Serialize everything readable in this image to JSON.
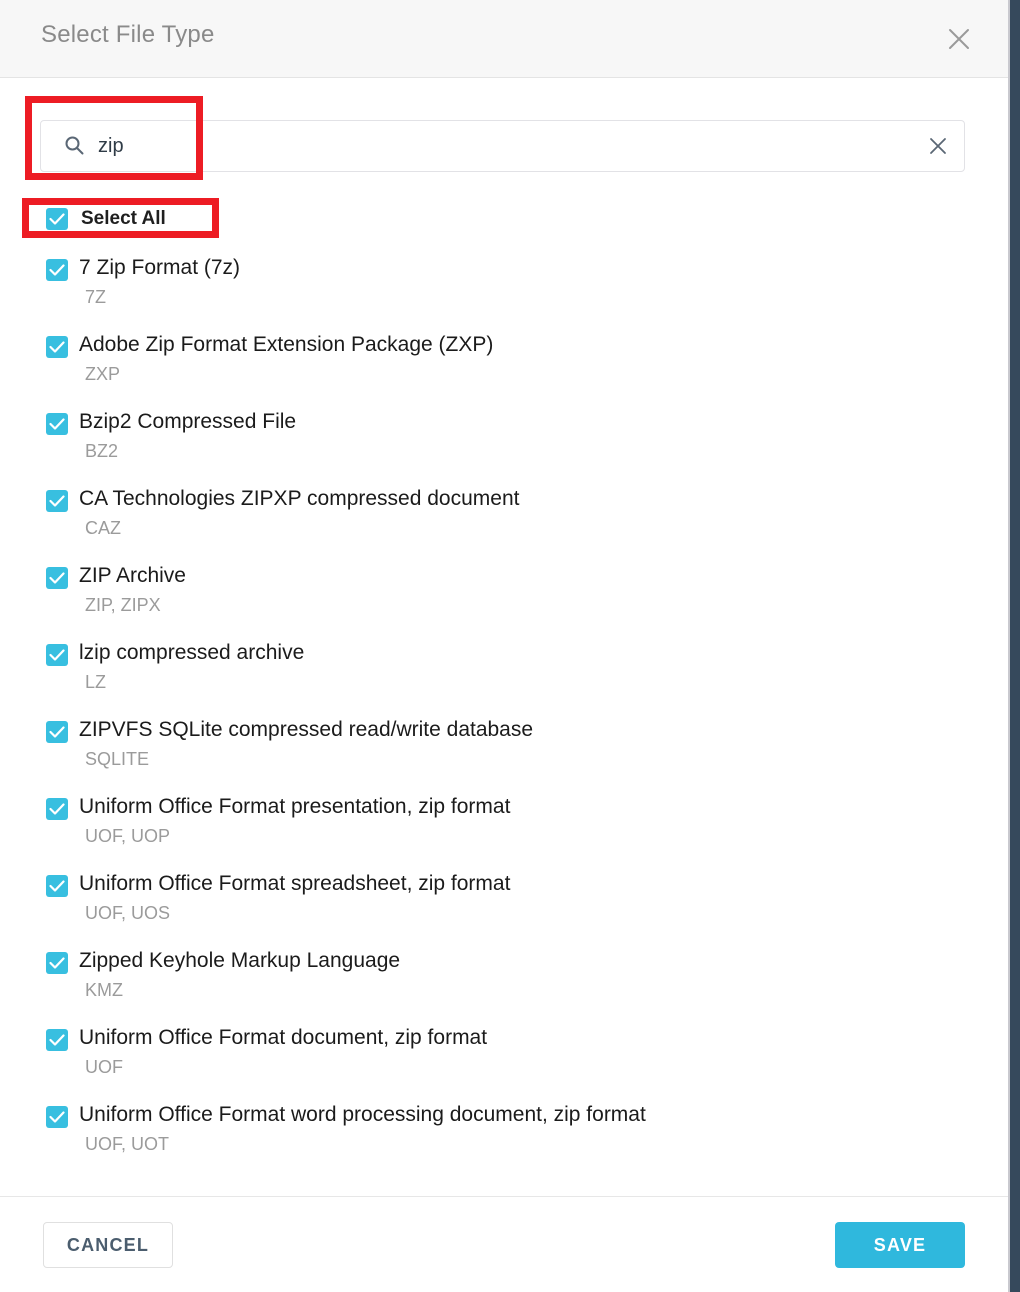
{
  "window": {
    "title": "Select File Type",
    "close_icon": "close-icon"
  },
  "search": {
    "icon": "search-icon",
    "value": "zip",
    "placeholder": "",
    "clear_icon": "clear-icon"
  },
  "select_all": {
    "label": "Select All",
    "checked": true
  },
  "file_types": [
    {
      "name": "7 Zip Format (7z)",
      "extensions": "7Z",
      "checked": true
    },
    {
      "name": "Adobe Zip Format Extension Package (ZXP)",
      "extensions": "ZXP",
      "checked": true
    },
    {
      "name": "Bzip2 Compressed File",
      "extensions": "BZ2",
      "checked": true
    },
    {
      "name": "CA Technologies ZIPXP compressed document",
      "extensions": "CAZ",
      "checked": true
    },
    {
      "name": "ZIP Archive",
      "extensions": "ZIP, ZIPX",
      "checked": true
    },
    {
      "name": "lzip compressed archive",
      "extensions": "LZ",
      "checked": true
    },
    {
      "name": "ZIPVFS SQLite compressed read/write database",
      "extensions": "SQLITE",
      "checked": true
    },
    {
      "name": "Uniform Office Format presentation, zip format",
      "extensions": "UOF, UOP",
      "checked": true
    },
    {
      "name": "Uniform Office Format spreadsheet, zip format",
      "extensions": "UOF, UOS",
      "checked": true
    },
    {
      "name": "Zipped Keyhole Markup Language",
      "extensions": "KMZ",
      "checked": true
    },
    {
      "name": "Uniform Office Format document, zip format",
      "extensions": "UOF",
      "checked": true
    },
    {
      "name": "Uniform Office Format word processing document, zip format",
      "extensions": "UOF, UOT",
      "checked": true
    }
  ],
  "footer": {
    "cancel_label": "CANCEL",
    "save_label": "SAVE"
  },
  "colors": {
    "accent": "#2fb8dd",
    "checkbox": "#38bfe0",
    "annotation": "#ed1c24",
    "header_bg": "#f7f7f7",
    "page_edge": "#36495c"
  },
  "annotations": [
    {
      "target": "search-input"
    },
    {
      "target": "select-all-checkbox"
    }
  ]
}
